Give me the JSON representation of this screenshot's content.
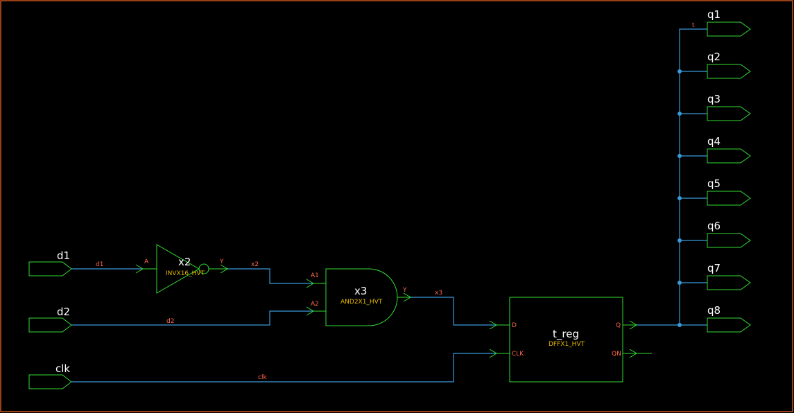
{
  "inputs": [
    {
      "name": "d1"
    },
    {
      "name": "d2"
    },
    {
      "name": "clk"
    }
  ],
  "outputs": [
    {
      "name": "q1"
    },
    {
      "name": "q2"
    },
    {
      "name": "q3"
    },
    {
      "name": "q4"
    },
    {
      "name": "q5"
    },
    {
      "name": "q6"
    },
    {
      "name": "q7"
    },
    {
      "name": "q8"
    }
  ],
  "inverter": {
    "instance": "x2",
    "cell": "INVX16_HVT",
    "pin_in": "A",
    "pin_out": "Y"
  },
  "and_gate": {
    "instance": "x3",
    "cell": "AND2X1_HVT",
    "pin_a1": "A1",
    "pin_a2": "A2",
    "pin_out": "Y"
  },
  "flop": {
    "instance": "t_reg",
    "cell": "DFFX1_HVT",
    "pin_d": "D",
    "pin_clk": "CLK",
    "pin_q": "Q",
    "pin_qn": "QN"
  },
  "nets": {
    "d1": "d1",
    "d2": "d2",
    "clk": "clk",
    "x2": "x2",
    "x3": "x3",
    "t": "t"
  },
  "colors": {
    "background": "#000000",
    "frame": "#ff6a2a",
    "symbol": "#33dd33",
    "wire": "#3a9ad9",
    "pin_text": "#ff6a4d",
    "cell_text": "#e6b800",
    "label_text": "#ffffff"
  }
}
